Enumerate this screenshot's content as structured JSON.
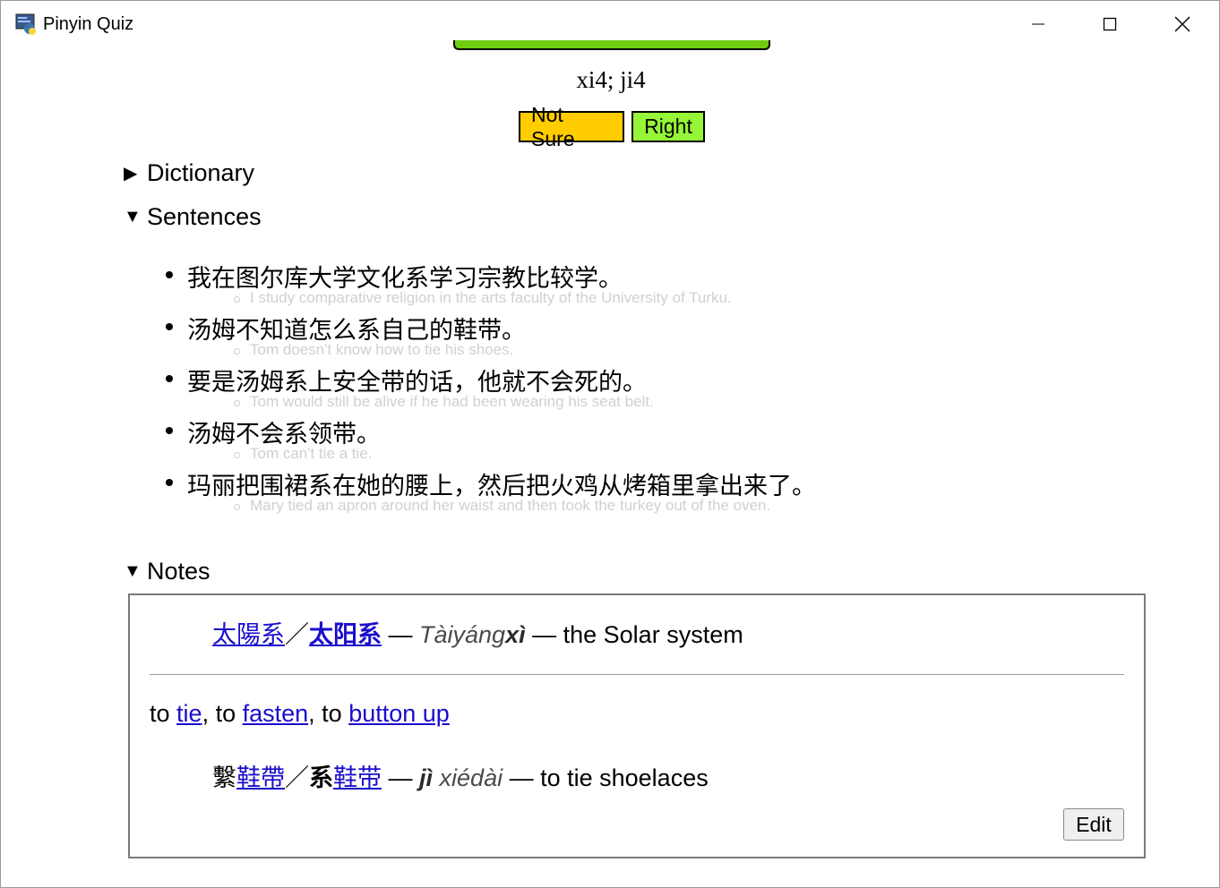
{
  "window": {
    "title": "Pinyin Quiz"
  },
  "quiz": {
    "progress_fraction": 1.0,
    "pinyin": "xi4; ji4",
    "not_sure_label": "Not Sure",
    "right_label": "Right"
  },
  "sections": {
    "dictionary": "Dictionary",
    "sentences": "Sentences",
    "notes": "Notes"
  },
  "sentences": [
    {
      "zh": "我在图尔库大学文化系学习宗教比较学。",
      "en": "I study comparative religion in the arts faculty of the University of Turku."
    },
    {
      "zh": "汤姆不知道怎么系自己的鞋带。",
      "en": "Tom doesn't know how to tie his shoes."
    },
    {
      "zh": "要是汤姆系上安全带的话，他就不会死的。",
      "en": "Tom would still be alive if he had been wearing his seat belt."
    },
    {
      "zh": "汤姆不会系领带。",
      "en": "Tom can't tie a tie."
    },
    {
      "zh": "玛丽把围裙系在她的腰上，然后把火鸡从烤箱里拿出来了。",
      "en": "Mary tied an apron around her waist and then took the turkey out of the oven."
    }
  ],
  "notes": {
    "entry1": {
      "trad": "太陽系",
      "slash": "／",
      "simp": "太阳系",
      "dash1": " — ",
      "pinyin_plain": "Tàiyáng",
      "pinyin_bold": "xì",
      "dash2": " — ",
      "meaning": "the Solar system"
    },
    "defs": {
      "to1": "to ",
      "tie": "tie",
      "sep1": ", to ",
      "fasten": "fasten",
      "sep2": ", to ",
      "button_up": "button up"
    },
    "entry2": {
      "trad_plain": "繫",
      "trad_link": "鞋帶",
      "slash": "／",
      "simp_plain": "系",
      "simp_link": "鞋带",
      "dash1": " — ",
      "pinyin_bold": "jì",
      "pinyin_plain": " xiédài",
      "dash2": " — ",
      "meaning": "to tie shoelaces"
    },
    "edit_label": "Edit"
  },
  "colors": {
    "progress": "#6fcc10",
    "not_sure": "#ffcc00",
    "right": "#95f536",
    "link": "#1a0dcc"
  }
}
